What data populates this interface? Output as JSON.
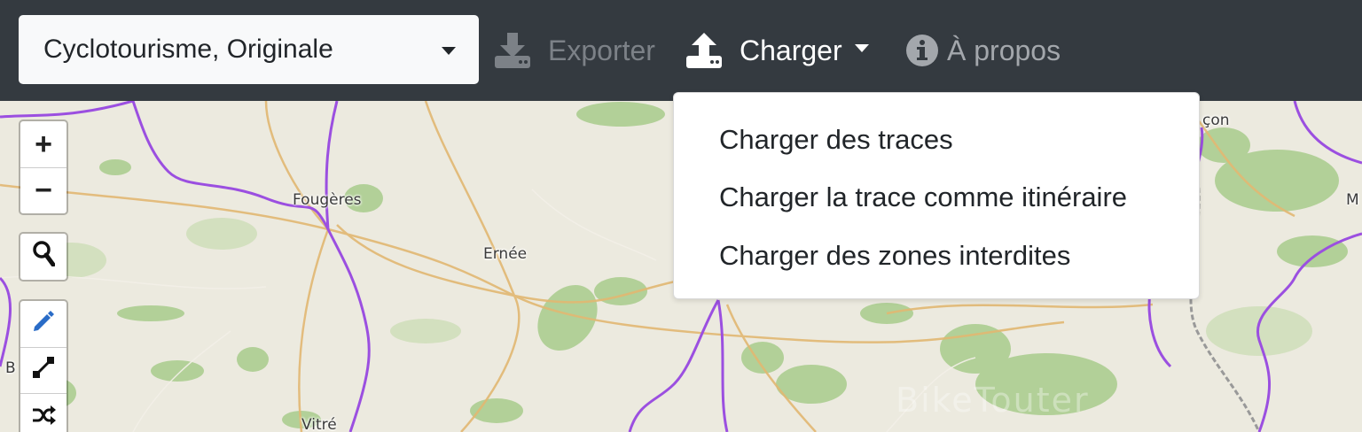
{
  "navbar": {
    "profile_select": {
      "value": "Cyclotourisme, Originale",
      "icon": "chevron-down-icon"
    },
    "export": {
      "label": "Exporter",
      "icon": "download-icon",
      "enabled": false
    },
    "load": {
      "label": "Charger",
      "icon": "upload-icon",
      "expanded": true
    },
    "about": {
      "label": "À propos",
      "icon": "info-circle-icon"
    }
  },
  "load_menu": {
    "items": [
      {
        "label": "Charger des traces"
      },
      {
        "label": "Charger la trace comme itinéraire"
      },
      {
        "label": "Charger des zones interdites"
      }
    ]
  },
  "map": {
    "places": [
      "Fougères",
      "Ernée",
      "Vitré",
      "çon",
      "M",
      "B"
    ],
    "watermark": "BikeTouter",
    "controls": {
      "zoom_in": "+",
      "zoom_out": "−",
      "search_icon": "search-icon",
      "draw_icon": "pencil-icon",
      "route_icon": "route-icon",
      "shuffle_icon": "shuffle-icon"
    }
  },
  "colors": {
    "navbar": "#343a40",
    "map_base": "#eceadf",
    "forest": "#a8cc8c",
    "boundary": "#9b4fe0",
    "road": "#e2b772"
  }
}
